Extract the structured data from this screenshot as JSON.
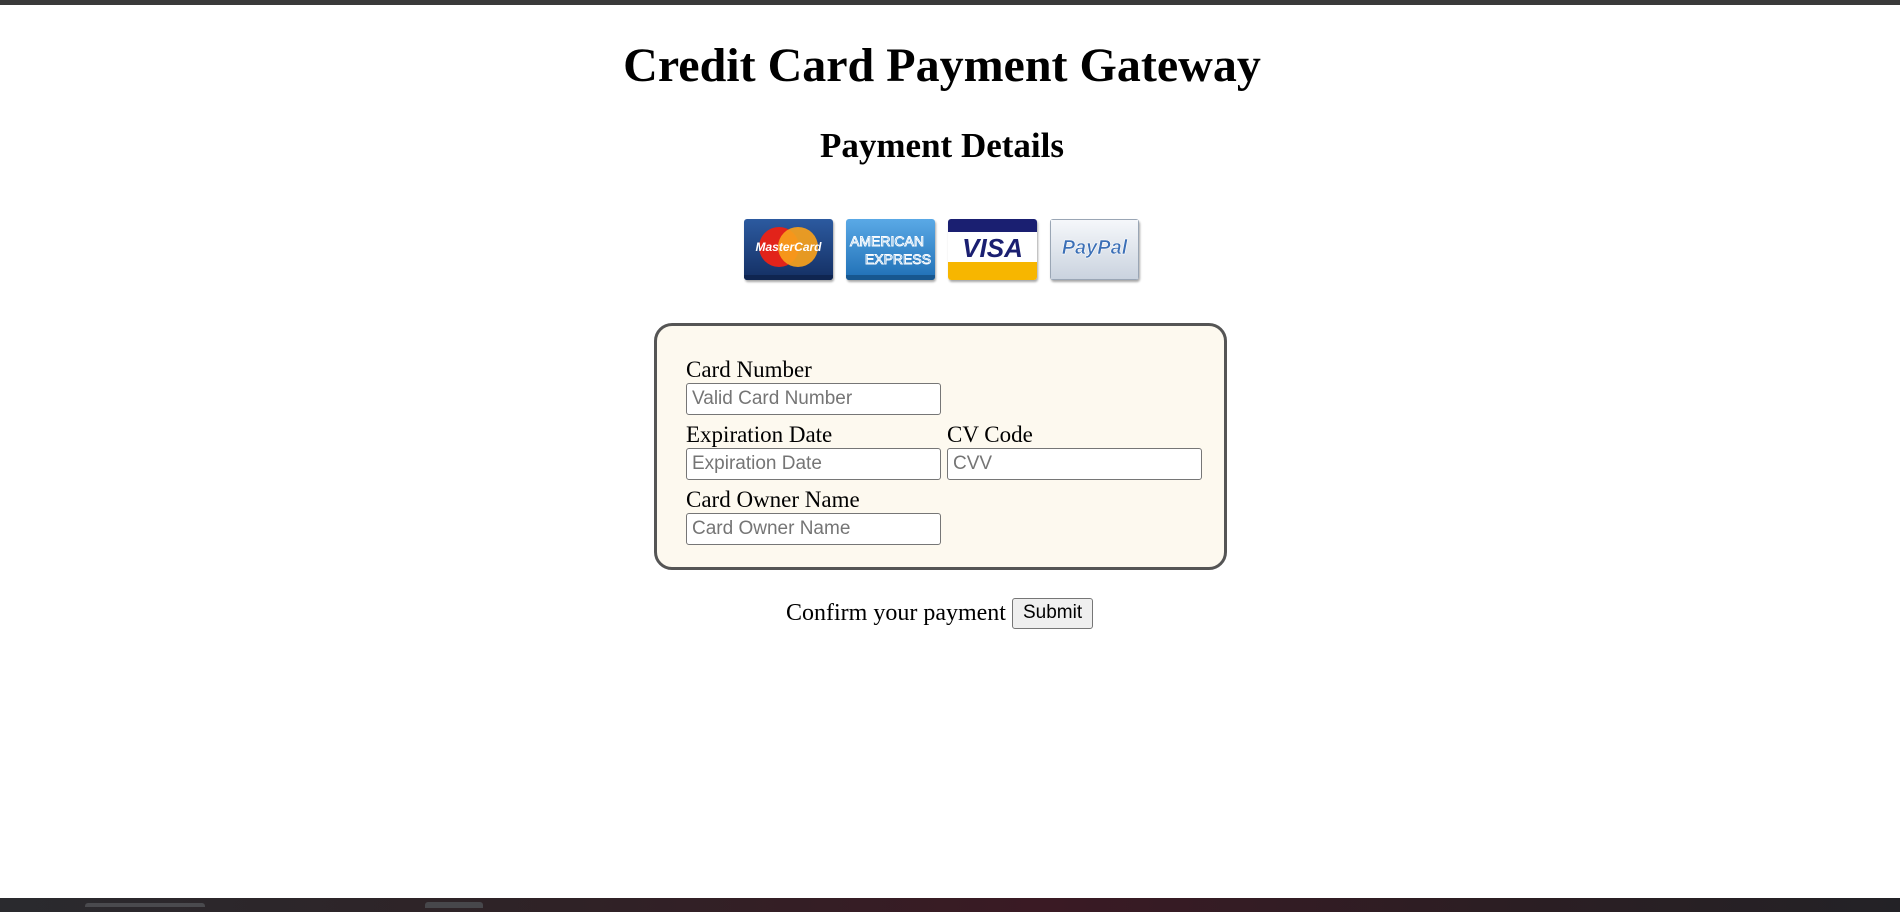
{
  "page": {
    "title": "Credit Card Payment Gateway",
    "subtitle": "Payment Details"
  },
  "card_logos": [
    {
      "name": "mastercard-logo",
      "text": "MasterCard",
      "colors": {
        "bg": "#1b3d78",
        "red": "#e2231a",
        "orange": "#f7a11b"
      }
    },
    {
      "name": "american-express-logo",
      "text_line1": "AMERICAN",
      "text_line2": "EXPRESS",
      "colors": {
        "bg": "#2e86c8"
      }
    },
    {
      "name": "visa-logo",
      "text": "VISA",
      "colors": {
        "top": "#1a1f71",
        "bottom": "#f7b600"
      }
    },
    {
      "name": "paypal-logo",
      "text": "PayPal",
      "colors": {
        "bg": "#e9eef5",
        "text": "#3b6fb6"
      }
    }
  ],
  "form": {
    "card_number": {
      "label": "Card Number",
      "placeholder": "Valid Card Number",
      "value": ""
    },
    "expiration_date": {
      "label": "Expiration Date",
      "placeholder": "Expiration Date",
      "value": ""
    },
    "cv_code": {
      "label": "CV Code",
      "placeholder": "CVV",
      "value": ""
    },
    "owner_name": {
      "label": "Card Owner Name",
      "placeholder": "Card Owner Name",
      "value": ""
    },
    "colors": {
      "background": "#fdf9ef",
      "border": "#555555"
    }
  },
  "confirm": {
    "text": "Confirm your payment",
    "submit_label": "Submit"
  }
}
